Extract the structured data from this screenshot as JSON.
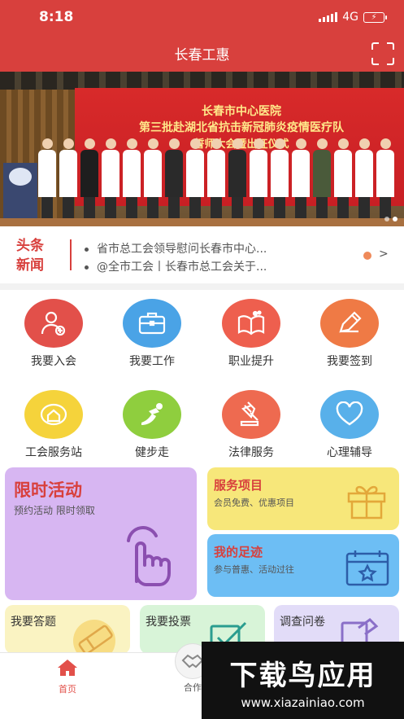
{
  "status": {
    "time": "8:18",
    "network": "4G",
    "battery_icon": "battery-charging-icon"
  },
  "header": {
    "title": "长春工惠",
    "scan_icon": "scan-icon"
  },
  "banner": {
    "line1": "长春市中心医院",
    "line2": "第三批赴湖北省抗击新冠肺炎疫情医疗队",
    "line3": "誓师大会暨出征仪式",
    "page_indicator": {
      "count": 2,
      "active": 2
    }
  },
  "news": {
    "badge_line1": "头条",
    "badge_line2": "新闻",
    "items": [
      "省市总工会领导慰问长春市中心...",
      "@全市工会丨长春市总工会关于..."
    ],
    "more": ">"
  },
  "grid": [
    {
      "label": "我要入会",
      "icon": "user-add-icon",
      "color": "#e2504a"
    },
    {
      "label": "我要工作",
      "icon": "briefcase-icon",
      "color": "#4aa3e6"
    },
    {
      "label": "职业提升",
      "icon": "book-icon",
      "color": "#ee5f4e"
    },
    {
      "label": "我要签到",
      "icon": "pencil-icon",
      "color": "#ef7a45"
    },
    {
      "label": "工会服务站",
      "icon": "house-icon",
      "color": "#f5d33b"
    },
    {
      "label": "健步走",
      "icon": "running-icon",
      "color": "#8fce3e"
    },
    {
      "label": "法律服务",
      "icon": "gavel-icon",
      "color": "#ee6a50"
    },
    {
      "label": "心理辅导",
      "icon": "heart-icon",
      "color": "#58b0ea"
    }
  ],
  "cards": {
    "limited": {
      "title": "限时活动",
      "subtitle": "预约活动 限时领取",
      "icon": "tap-hand-icon",
      "bg": "#d7b6f2",
      "title_color": "#d8403d"
    },
    "services": {
      "title": "服务项目",
      "subtitle": "会员免费、优惠项目",
      "icon": "gift-box-icon",
      "bg": "#f7e77a",
      "title_color": "#d8403d"
    },
    "footprint": {
      "title": "我的足迹",
      "subtitle": "参与普惠、活动过往",
      "icon": "calendar-star-icon",
      "bg": "#6dbef4",
      "title_color": "#d8403d"
    },
    "answer": {
      "title": "我要答题",
      "icon": "eraser-icon",
      "bg": "#faf3c2"
    },
    "vote": {
      "title": "我要投票",
      "icon": "checkbox-icon",
      "bg": "#d8f4d8"
    },
    "survey": {
      "title": "调查问卷",
      "icon": "document-icon",
      "bg": "#e2dcf8"
    }
  },
  "bottom_nav": [
    {
      "label": "首页",
      "icon": "home-icon",
      "active": true
    },
    {
      "label": "合作",
      "icon": "handshake-icon",
      "active": false
    }
  ],
  "watermark": {
    "title": "下载鸟应用",
    "url": "www.xiazainiao.com"
  }
}
